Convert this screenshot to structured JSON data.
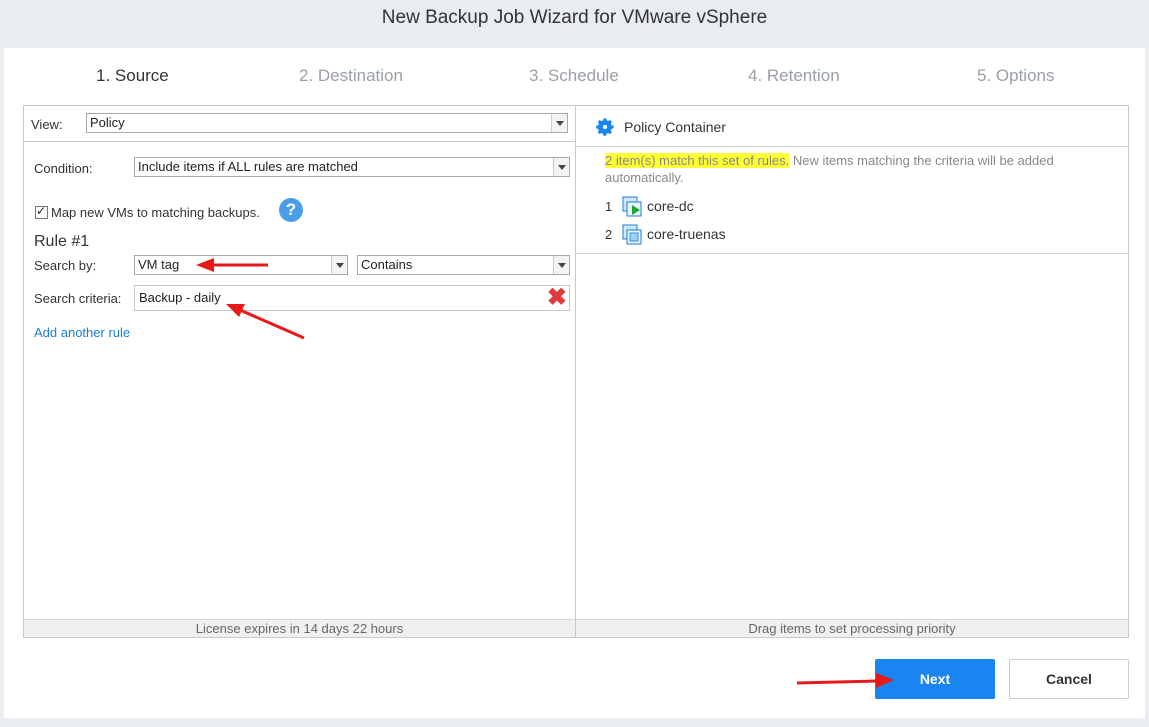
{
  "window": {
    "title": "New Backup Job Wizard for VMware vSphere"
  },
  "steps": [
    {
      "label": "1. Source",
      "active": true
    },
    {
      "label": "2. Destination",
      "active": false
    },
    {
      "label": "3. Schedule",
      "active": false
    },
    {
      "label": "4. Retention",
      "active": false
    },
    {
      "label": "5. Options",
      "active": false
    }
  ],
  "left_panel": {
    "view_label": "View:",
    "view_value": "Policy",
    "condition_label": "Condition:",
    "condition_value": "Include items if ALL rules are matched",
    "map_checkbox_label": "Map new VMs to matching backups.",
    "map_checked": true,
    "help_icon_glyph": "?",
    "rule_title": "Rule #1",
    "search_by_label": "Search by:",
    "search_by_value": "VM tag",
    "operator_value": "Contains",
    "search_criteria_label": "Search criteria:",
    "search_criteria_value": "Backup - daily",
    "clear_icon_glyph": "✖",
    "add_rule_link": "Add another rule",
    "footer": "License expires in 14 days 22 hours"
  },
  "right_panel": {
    "title": "Policy Container",
    "match_highlight": "2 item(s) match this set of rules.",
    "match_rest": " New items matching the criteria will be added automatically.",
    "items": [
      {
        "index": "1",
        "name": "core-dc",
        "running": true
      },
      {
        "index": "2",
        "name": "core-truenas",
        "running": false
      }
    ],
    "footer": "Drag items to set processing priority"
  },
  "buttons": {
    "next": "Next",
    "cancel": "Cancel"
  },
  "colors": {
    "accent": "#1a84f0",
    "highlight": "#ffff33",
    "link": "#1a7fd4",
    "clear": "#e03b3b",
    "annotation_arrow": "#e8191a"
  }
}
